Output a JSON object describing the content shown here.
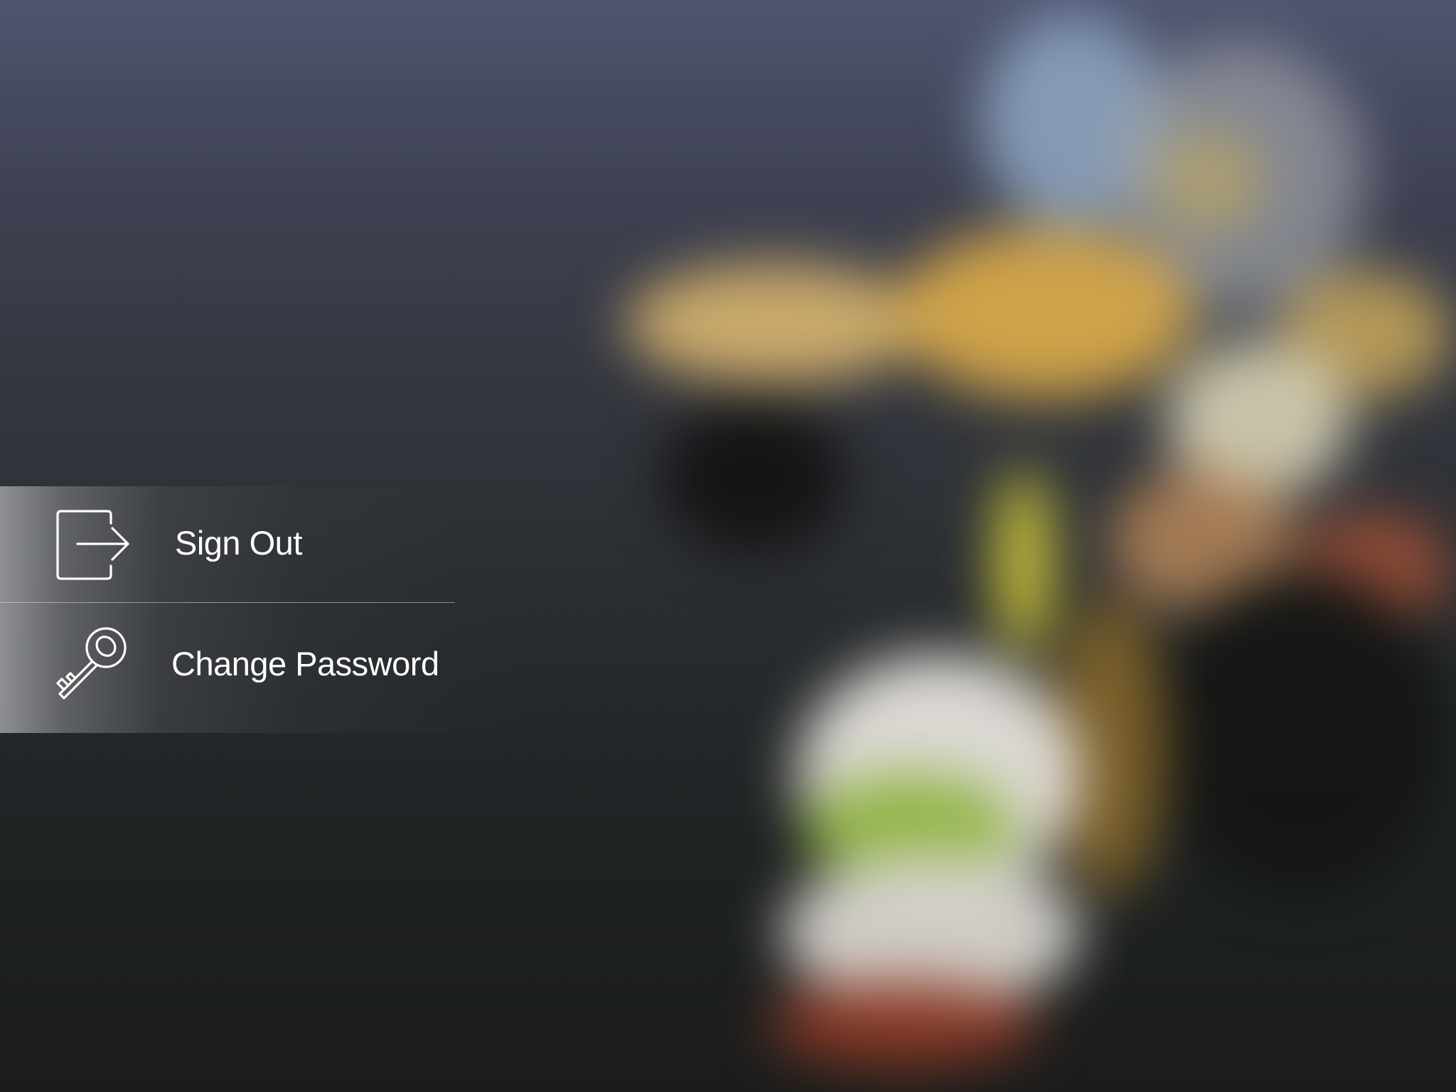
{
  "menu": {
    "items": [
      {
        "label": "Sign Out",
        "icon": "sign-out-icon"
      },
      {
        "label": "Change Password",
        "icon": "key-icon"
      }
    ]
  },
  "colors": {
    "text": "#ffffff",
    "background_top": "#4f5470",
    "background_bottom": "#1b1d1c"
  }
}
